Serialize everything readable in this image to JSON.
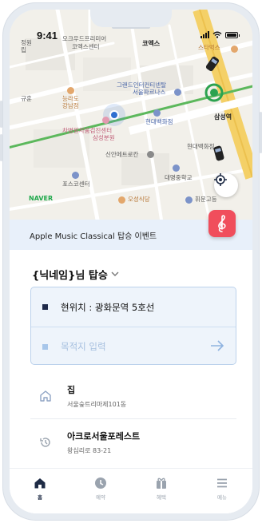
{
  "status_bar": {
    "time": "9:41"
  },
  "map": {
    "labels": {
      "jeongwon": "정원",
      "rip": "립",
      "okugoodo": "오크우드프리미어",
      "coexcenter": "코엑스센터",
      "coex": "코엑스",
      "starbucks": "스타벅스",
      "gyuhun": "규훈",
      "nungra": "능라도",
      "gangnam": "강남점",
      "grandinter": "그랜드인터컨티넨탈",
      "seoulparnas": "서울파르나스",
      "hyundai1": "현대백화점",
      "samsung_station": "삼성역",
      "cha": "차병원차움검진센터",
      "samsung_bunwon": "삼성분원",
      "shinan": "신안메트로칸",
      "hyundai2": "현대백화점",
      "posco": "포스코센터",
      "daemyeong": "대명중학교",
      "naver": "NAVER",
      "oseong": "오성식당",
      "hwimun": "휘문고등"
    }
  },
  "banner": {
    "text": "Apple Music Classical 탑승 이벤트"
  },
  "panel": {
    "title": "{닉네임}님 탑승",
    "origin": "현위치 : 광화문역 5호선",
    "destination_placeholder": "목적지 입력",
    "favorites": [
      {
        "title": "집",
        "subtitle": "서울숲트리마제101동"
      },
      {
        "title": "아크로서울포레스트",
        "subtitle": "왕십리로 83-21"
      }
    ]
  },
  "tabs": [
    {
      "label": "홈",
      "active": true,
      "icon": "home-icon"
    },
    {
      "label": "예약",
      "active": false,
      "icon": "clock-icon"
    },
    {
      "label": "혜택",
      "active": false,
      "icon": "gift-icon"
    },
    {
      "label": "메뉴",
      "active": false,
      "icon": "menu-icon"
    }
  ],
  "colors": {
    "accent": "#1e2b45",
    "banner_bg": "#e8f0fa",
    "card_border": "#bcd2ec",
    "music_icon": "#f04e5c"
  }
}
